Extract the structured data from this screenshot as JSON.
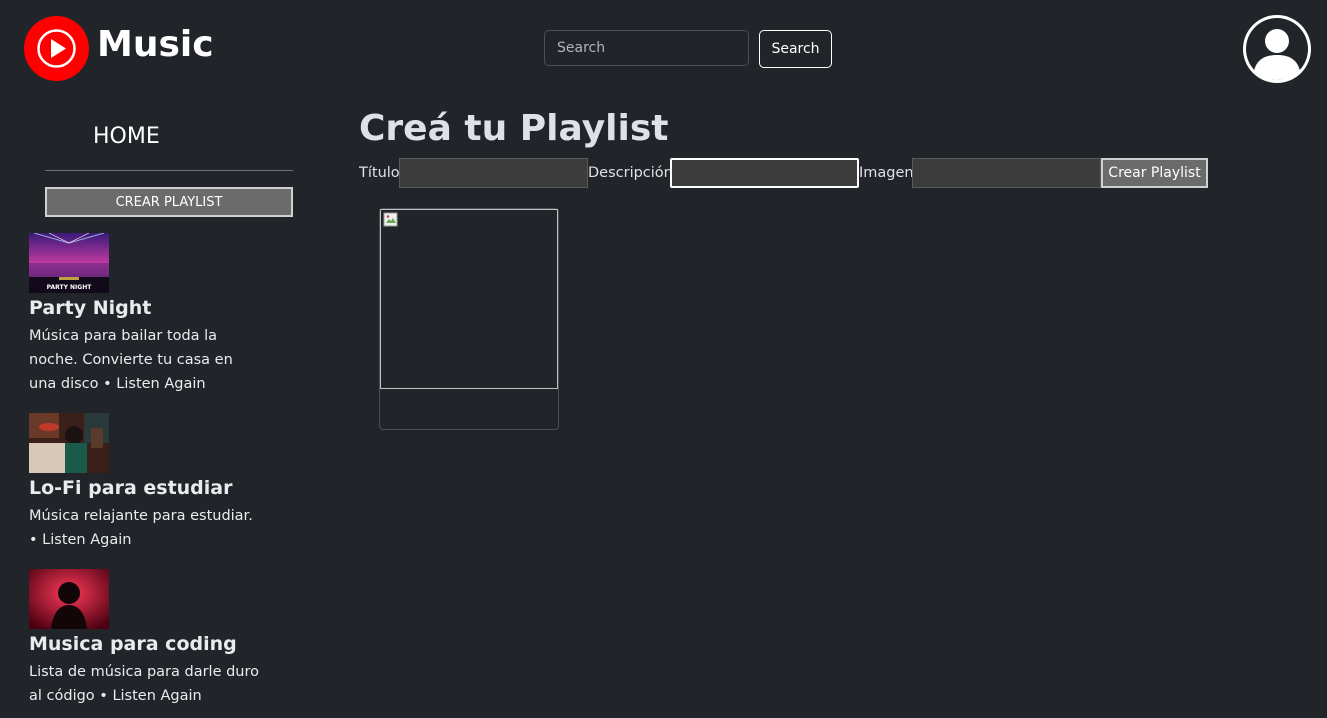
{
  "header": {
    "logo_icon": "youtube-music-play-icon",
    "logo_text": "Music",
    "search": {
      "placeholder": "Search",
      "value": ""
    },
    "search_button_label": "Search",
    "avatar_icon": "user-avatar-icon"
  },
  "sidebar": {
    "home_label": "HOME",
    "crear_playlist_label": "CREAR PLAYLIST",
    "playlists": [
      {
        "title": "Party Night",
        "description": "Música para bailar toda la noche. Convierte tu casa en una disco • Listen Again",
        "thumb_caption": "PARTY NIGHT"
      },
      {
        "title": "Lo-Fi para estudiar",
        "description": "Música relajante para estudiar. • Listen Again"
      },
      {
        "title": "Musica para coding",
        "description": "Lista de música para darle duro al código • Listen Again"
      }
    ]
  },
  "main": {
    "title": "Creá tu Playlist",
    "form": {
      "titulo_label": "Título",
      "descripcion_label": "Descripción",
      "imagen_label": "Imagen",
      "titulo_value": "",
      "descripcion_value": "",
      "imagen_value": "",
      "submit_label": "Crear Playlist"
    }
  },
  "colors": {
    "background": "#212529",
    "brand_red": "#ff0000",
    "button_gray": "#6b6b6b",
    "input_gray": "#3c3c3c"
  }
}
